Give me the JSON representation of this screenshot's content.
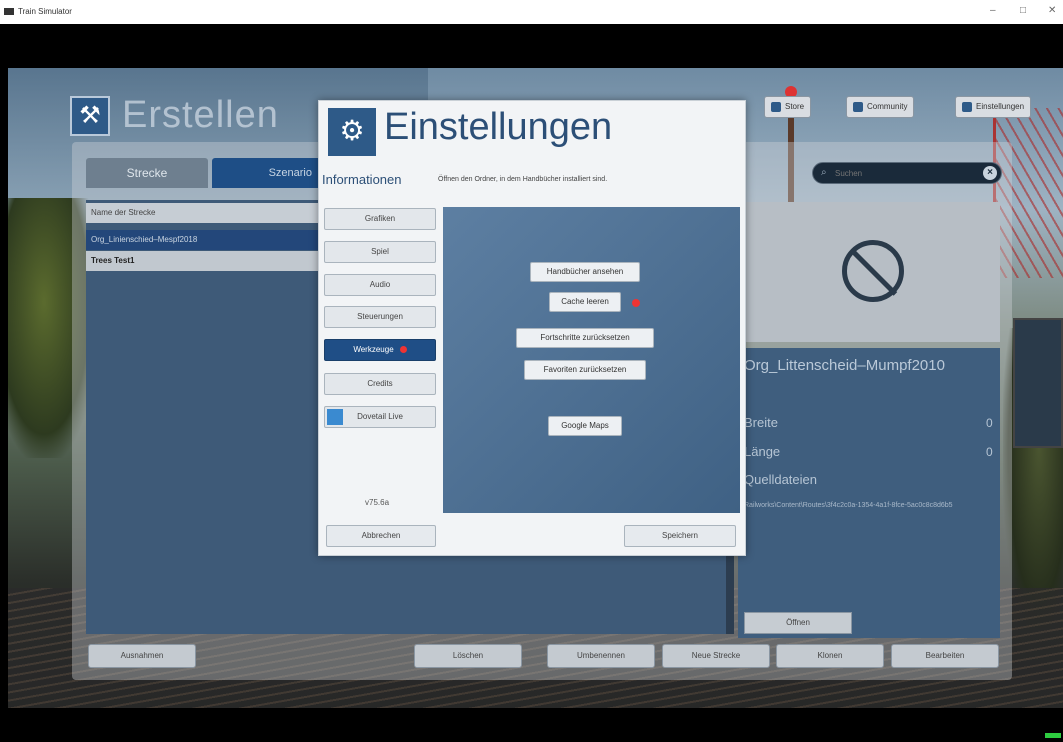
{
  "window": {
    "title": "Train Simulator",
    "controls": [
      "–",
      "□",
      "✕"
    ]
  },
  "brand": {
    "title": "Erstellen"
  },
  "tabs": [
    {
      "label": "Strecke"
    },
    {
      "label": "Szenario"
    }
  ],
  "list": {
    "header": "Name der Strecke",
    "rows": [
      "Org_Linienschied–Mespf2018",
      "Trees Test1"
    ]
  },
  "top_buttons": [
    {
      "label": "Store"
    },
    {
      "label": "Community"
    },
    {
      "label": "Einstellungen"
    }
  ],
  "search": {
    "placeholder": "Suchen"
  },
  "details": {
    "title": "Org_Littenscheid–Mumpf2010",
    "rows": [
      {
        "label": "Breite",
        "value": "0"
      },
      {
        "label": "Länge",
        "value": "0"
      },
      {
        "label": "Quelldateien",
        "value": ""
      }
    ],
    "path": "Railworks\\Content\\Routes\\3f4c2c0a-1354-4a1f-8fce-5ac0c8c8d6b5",
    "open_label": "Öffnen"
  },
  "bottom_buttons": [
    {
      "label": "Ausnahmen"
    },
    {
      "label": "Löschen"
    },
    {
      "label": "Umbenennen"
    },
    {
      "label": "Neue Strecke"
    },
    {
      "label": "Klonen"
    },
    {
      "label": "Bearbeiten"
    }
  ],
  "dialog": {
    "title": "Einstellungen",
    "subtitle": "Informationen",
    "hint": "Öffnen den Ordner, in dem Handbücher installiert sind.",
    "sidebar": [
      {
        "label": "Grafiken"
      },
      {
        "label": "Spiel"
      },
      {
        "label": "Audio"
      },
      {
        "label": "Steuerungen"
      },
      {
        "label": "Werkzeuge"
      },
      {
        "label": "Credits"
      },
      {
        "label": "Dovetail Live"
      }
    ],
    "version": "v75.6a",
    "cancel_label": "Abbrechen",
    "save_label": "Speichern",
    "tools": [
      {
        "label": "Handbücher ansehen"
      },
      {
        "label": "Cache leeren"
      },
      {
        "label": "Fortschritte zurücksetzen"
      },
      {
        "label": "Favoriten zurücksetzen"
      },
      {
        "label": "Google Maps"
      }
    ]
  },
  "colors": {
    "accent": "#1f4e86",
    "panel": "#3f5e7e",
    "alert": "#e33333"
  }
}
